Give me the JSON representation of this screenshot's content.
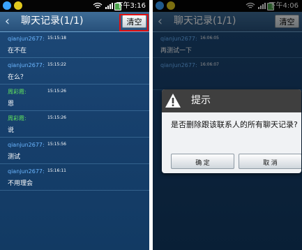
{
  "left_screen": {
    "status_time": "下午3:16",
    "title": "聊天记录(1/1)",
    "clear_label": "清空",
    "messages": [
      {
        "sender": "qianjun2677:",
        "time": "15:15:18",
        "text": "在不在"
      },
      {
        "sender": "qianjun2677:",
        "time": "15:15:22",
        "text": "在么？"
      },
      {
        "sender": "周彩霞:",
        "time": "15:15:26",
        "text": "恩"
      },
      {
        "sender": "周彩霞:",
        "time": "15:15:26",
        "text": "说"
      },
      {
        "sender": "qianjun2677:",
        "time": "15:15:56",
        "text": "测试"
      },
      {
        "sender": "qianjun2677:",
        "time": "15:16:11",
        "text": "不用理会"
      }
    ]
  },
  "right_screen": {
    "status_time": "下午4:06",
    "title": "聊天记录(1/1)",
    "clear_label": "清空",
    "messages": [
      {
        "sender": "qianjun2677:",
        "time": "16:06:05",
        "text": "再测试一下"
      },
      {
        "sender": "qianjun2677:",
        "time": "16:06:07",
        "text": ""
      }
    ],
    "dialog": {
      "title": "提示",
      "message": "是否删除跟该联系人的所有聊天记录?",
      "ok_label": "确 定",
      "cancel_label": "取 消"
    }
  },
  "colors": {
    "screen_background": "#17406d",
    "title_bar": "#2e5a84",
    "sender_blue": "#6bb6ff",
    "sender_green": "#5ee05e",
    "highlight": "#e30f0f"
  },
  "icons": {
    "back": "back-arrow-icon",
    "wifi": "wifi-icon",
    "warning": "warning-icon"
  }
}
